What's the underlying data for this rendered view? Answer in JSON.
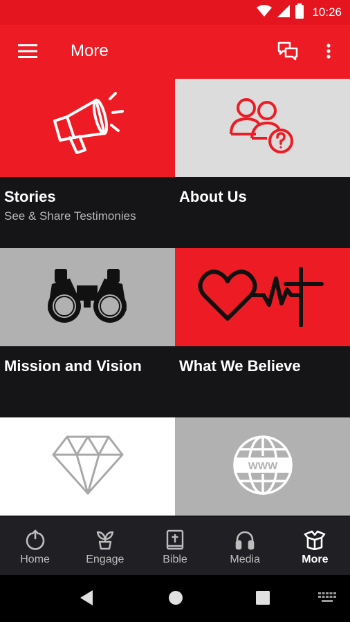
{
  "status_bar": {
    "time": "10:26",
    "icons": [
      "wifi-icon",
      "cellular-signal-icon",
      "battery-icon"
    ]
  },
  "app_bar": {
    "title": "More",
    "menu_icon": "hamburger-menu-icon",
    "chat_icon": "chat-bubbles-icon",
    "overflow_icon": "more-vertical-icon"
  },
  "tiles": [
    {
      "title": "Stories",
      "subtitle": "See & Share Testimonies",
      "icon": "megaphone-icon",
      "bg": "#ed1c24",
      "icon_color": "#ffffff"
    },
    {
      "title": "About Us",
      "subtitle": "",
      "icon": "people-question-icon",
      "bg": "#dcdcdc",
      "icon_color": "#ed1c24"
    },
    {
      "title": "Mission and Vision",
      "subtitle": "",
      "icon": "binoculars-icon",
      "bg": "#b1b1b1",
      "icon_color": "#111111"
    },
    {
      "title": "What We Believe",
      "subtitle": "",
      "icon": "heartbeat-cross-icon",
      "bg": "#ed1c24",
      "icon_color": "#111111"
    },
    {
      "title": "",
      "subtitle": "",
      "icon": "diamond-icon",
      "bg": "#ffffff",
      "icon_color": "#a8a8a8"
    },
    {
      "title": "",
      "subtitle": "",
      "icon": "globe-www-icon",
      "bg": "#b1b1b1",
      "icon_color": "#ffffff"
    }
  ],
  "bottom_nav": {
    "active": "More",
    "items": [
      {
        "label": "Home",
        "icon": "power-home-icon"
      },
      {
        "label": "Engage",
        "icon": "seedling-icon"
      },
      {
        "label": "Bible",
        "icon": "bible-icon"
      },
      {
        "label": "Media",
        "icon": "headphones-icon"
      },
      {
        "label": "More",
        "icon": "open-box-icon"
      }
    ]
  },
  "system_nav": {
    "icons": [
      "back-icon",
      "home-circle-icon",
      "recents-square-icon",
      "keyboard-icon"
    ]
  },
  "colors": {
    "primary": "#ed1c24",
    "status_bar": "#e5151f",
    "dark_background": "#151517",
    "nav_background": "#202024"
  }
}
